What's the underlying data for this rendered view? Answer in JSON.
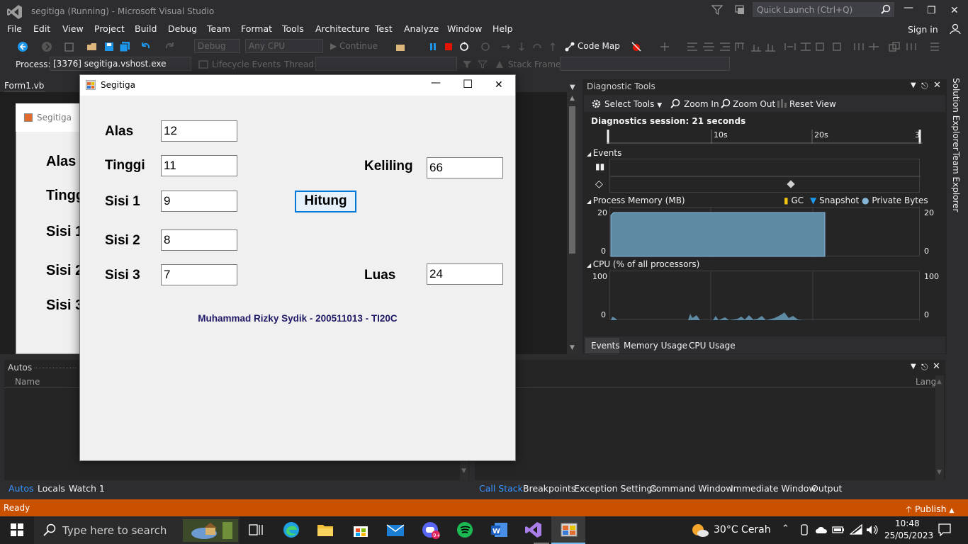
{
  "app": {
    "title": "segitiga (Running) - Microsoft Visual Studio",
    "quick_launch": "Quick Launch (Ctrl+Q)",
    "sign_in": "Sign in"
  },
  "menu": [
    "File",
    "Edit",
    "View",
    "Project",
    "Build",
    "Debug",
    "Team",
    "Format",
    "Tools",
    "Architecture",
    "Test",
    "Analyze",
    "Window",
    "Help"
  ],
  "toolbar": {
    "config": "Debug",
    "platform": "Any CPU",
    "continue": "Continue",
    "code_map": "Code Map"
  },
  "toolbar2": {
    "process_label": "Process:",
    "process_value": "[3376] segitiga.vshost.exe",
    "lifecycle": "Lifecycle Events",
    "thread_label": "Thread:",
    "stack_frame_label": "Stack Frame:"
  },
  "document": {
    "tab": "Form1.vb",
    "designer_title": "Segitiga",
    "labels": [
      "Alas",
      "Tingg",
      "Sisi 1",
      "Sisi 2",
      "Sisi 3"
    ]
  },
  "diagnostics": {
    "title": "Diagnostic Tools",
    "select_tools": "Select Tools",
    "zoom_in": "Zoom In",
    "zoom_out": "Zoom Out",
    "reset_view": "Reset View",
    "session": "Diagnostics session: 21 seconds",
    "ruler": [
      "10s",
      "20s",
      "3"
    ],
    "events_header": "Events",
    "memory_header": "Process Memory (MB)",
    "legend": [
      "GC",
      "Snapshot",
      "Private Bytes"
    ],
    "mem_max": "20",
    "mem_min": "0",
    "cpu_header": "CPU (% of all processors)",
    "cpu_max": "100",
    "cpu_min": "0",
    "tabs": [
      "Events",
      "Memory Usage",
      "CPU Usage"
    ]
  },
  "sidebar": [
    "Solution Explorer",
    "Team Explorer"
  ],
  "autos": {
    "title": "Autos",
    "col_name": "Name",
    "col_lang": "Lang"
  },
  "bottom_tabs_left": [
    "Autos",
    "Locals",
    "Watch 1"
  ],
  "bottom_tabs_right": [
    "Call Stack",
    "Breakpoints",
    "Exception Settings",
    "Command Window",
    "Immediate Window",
    "Output"
  ],
  "status": {
    "text": "Ready",
    "publish": "Publish"
  },
  "form": {
    "title": "Segitiga",
    "alas_label": "Alas",
    "alas_value": "12",
    "tinggi_label": "Tinggi",
    "tinggi_value": "11",
    "sisi1_label": "Sisi 1",
    "sisi1_value": "9",
    "sisi2_label": "Sisi 2",
    "sisi2_value": "8",
    "sisi3_label": "Sisi 3",
    "sisi3_value": "7",
    "keliling_label": "Keliling",
    "keliling_value": "66",
    "luas_label": "Luas",
    "luas_value": "24",
    "button": "Hitung",
    "credit": "Muhammad Rizky Sydik - 200511013 - TI20C"
  },
  "taskbar": {
    "search_placeholder": "Type here to search",
    "weather": "30°C  Cerah",
    "time": "10:48",
    "date": "25/05/2023"
  },
  "colors": {
    "accent": "#007acc",
    "status_bar": "#ca5100",
    "memory_fill": "#6a96ae",
    "button_border": "#0078d7"
  }
}
